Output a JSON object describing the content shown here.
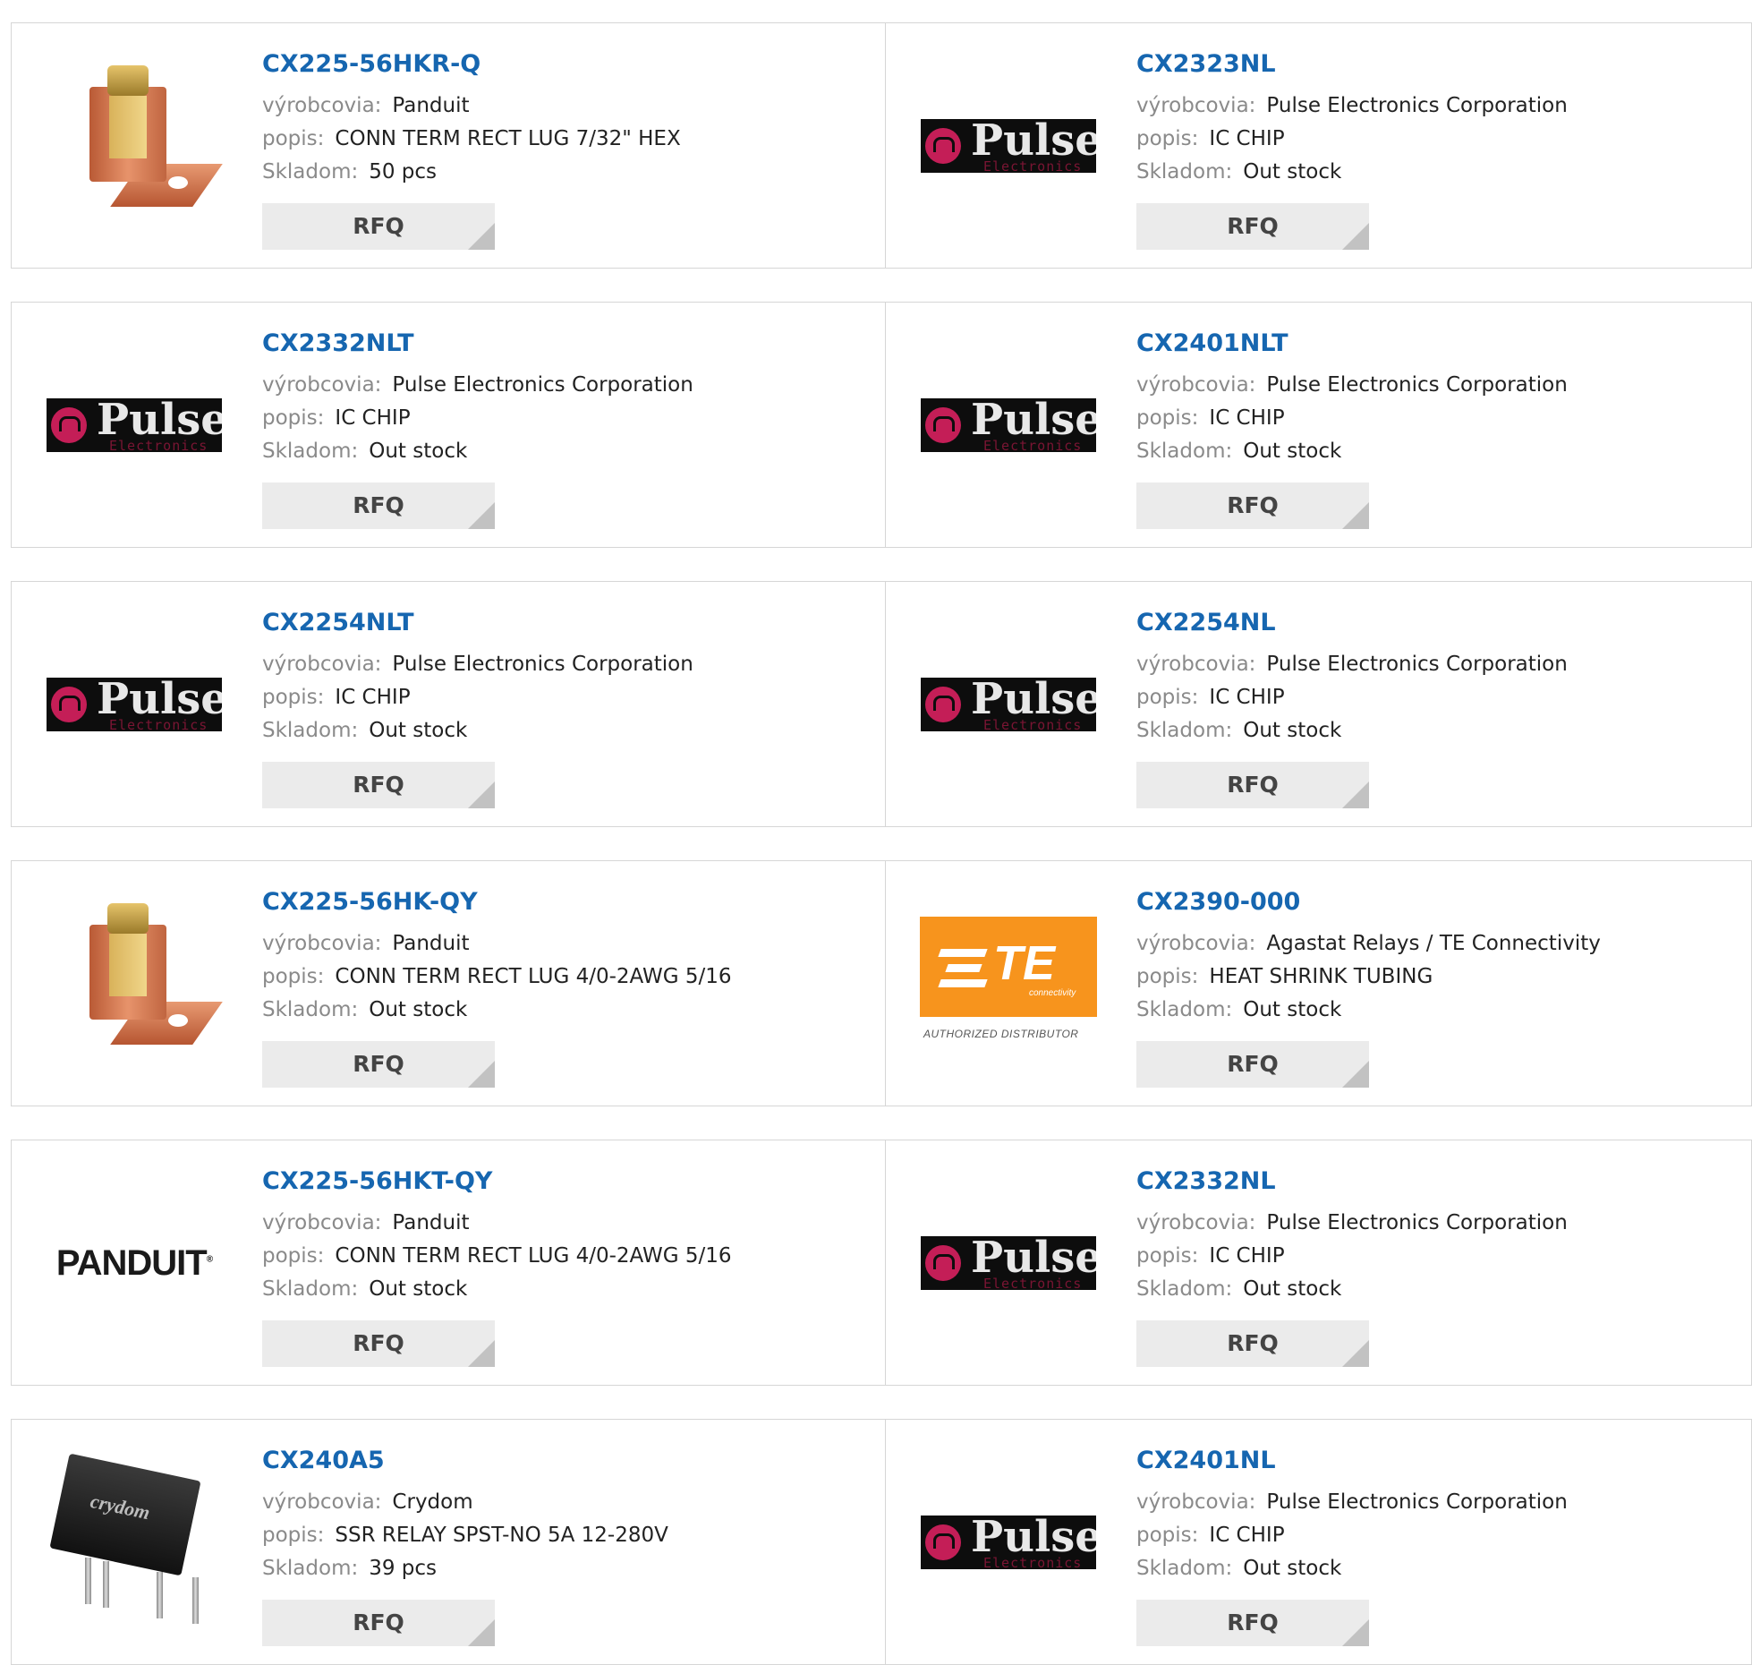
{
  "labels": {
    "manufacturer": "výrobcovia:",
    "description": "popis:",
    "stock": "Skladom:",
    "rfq": "RFQ"
  },
  "logos": {
    "pulse_word": "Pulse",
    "pulse_sub": "Electronics",
    "te_word": "TE",
    "te_sub": "connectivity",
    "te_auth": "AUTHORIZED DISTRIBUTOR",
    "panduit_word": "PANDUIT",
    "crydom_word": "crydom"
  },
  "colors": {
    "part_link": "#1666b0",
    "rfq_bg": "#ebebeb",
    "pulse_red": "#c41e57",
    "te_orange": "#f7941d"
  },
  "products": [
    {
      "part": "CX225-56HKR-Q",
      "manufacturer": "Panduit",
      "description": "CONN TERM RECT LUG 7/32\" HEX",
      "stock": "50 pcs",
      "image": "copper-lug"
    },
    {
      "part": "CX2323NL",
      "manufacturer": "Pulse Electronics Corporation",
      "description": "IC CHIP",
      "stock": "Out stock",
      "image": "pulse-logo"
    },
    {
      "part": "CX2332NLT",
      "manufacturer": "Pulse Electronics Corporation",
      "description": "IC CHIP",
      "stock": "Out stock",
      "image": "pulse-logo"
    },
    {
      "part": "CX2401NLT",
      "manufacturer": "Pulse Electronics Corporation",
      "description": "IC CHIP",
      "stock": "Out stock",
      "image": "pulse-logo"
    },
    {
      "part": "CX2254NLT",
      "manufacturer": "Pulse Electronics Corporation",
      "description": "IC CHIP",
      "stock": "Out stock",
      "image": "pulse-logo"
    },
    {
      "part": "CX2254NL",
      "manufacturer": "Pulse Electronics Corporation",
      "description": "IC CHIP",
      "stock": "Out stock",
      "image": "pulse-logo"
    },
    {
      "part": "CX225-56HK-QY",
      "manufacturer": "Panduit",
      "description": "CONN TERM RECT LUG 4/0-2AWG 5/16",
      "stock": "Out stock",
      "image": "copper-lug"
    },
    {
      "part": "CX2390-000",
      "manufacturer": "Agastat Relays / TE Connectivity",
      "description": "HEAT SHRINK TUBING",
      "stock": "Out stock",
      "image": "te-logo"
    },
    {
      "part": "CX225-56HKT-QY",
      "manufacturer": "Panduit",
      "description": "CONN TERM RECT LUG 4/0-2AWG 5/16",
      "stock": "Out stock",
      "image": "panduit-logo"
    },
    {
      "part": "CX2332NL",
      "manufacturer": "Pulse Electronics Corporation",
      "description": "IC CHIP",
      "stock": "Out stock",
      "image": "pulse-logo"
    },
    {
      "part": "CX240A5",
      "manufacturer": "Crydom",
      "description": "SSR RELAY SPST-NO 5A 12-280V",
      "stock": "39 pcs",
      "image": "crydom-relay"
    },
    {
      "part": "CX2401NL",
      "manufacturer": "Pulse Electronics Corporation",
      "description": "IC CHIP",
      "stock": "Out stock",
      "image": "pulse-logo"
    }
  ]
}
